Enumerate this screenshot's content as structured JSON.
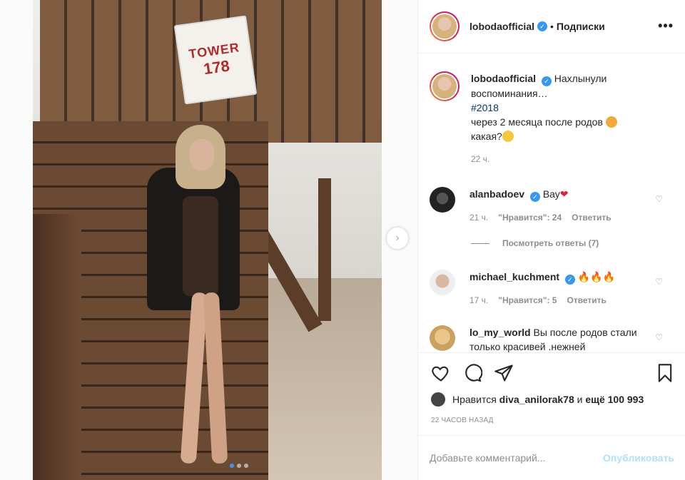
{
  "post": {
    "image_dots": 3,
    "active_dot": 0,
    "sign": {
      "line1": "TOWER",
      "line2": "178"
    }
  },
  "header": {
    "username": "lobodaofficial",
    "separator": "•",
    "follow_label": "Подписки",
    "more_label": "•••"
  },
  "caption": {
    "username": "lobodaofficial",
    "text_line1": "Нахлынули воспоминания…",
    "hashtag": "#2018",
    "text_line2": "через 2 месяца после родов",
    "text_line3": "какая?",
    "time": "22 ч."
  },
  "comments": [
    {
      "username": "alanbadoev",
      "verified": true,
      "text": "Вау",
      "time": "21 ч.",
      "likes": "\"Нравится\": 24",
      "reply": "Ответить"
    },
    {
      "username": "michael_kuchment",
      "verified": true,
      "text": "",
      "time": "17 ч.",
      "likes": "\"Нравится\": 5",
      "reply": "Ответить"
    },
    {
      "username": "lo_my_world",
      "verified": false,
      "text": "Вы после родов стали только красивей .нежней"
    }
  ],
  "view_replies": "Посмотреть ответы (7)",
  "likes": {
    "prefix": "Нравится",
    "user": "diva_anilorak78",
    "and": "и",
    "more": "ещё 100 993"
  },
  "time_ago": "22 ЧАСОВ НАЗАД",
  "add_comment": {
    "placeholder": "Добавьте комментарий...",
    "publish": "Опубликовать"
  },
  "colors": {
    "accent": "#3897f0",
    "publish_disabled": "#b2dffc",
    "heart": "#ed4956"
  }
}
